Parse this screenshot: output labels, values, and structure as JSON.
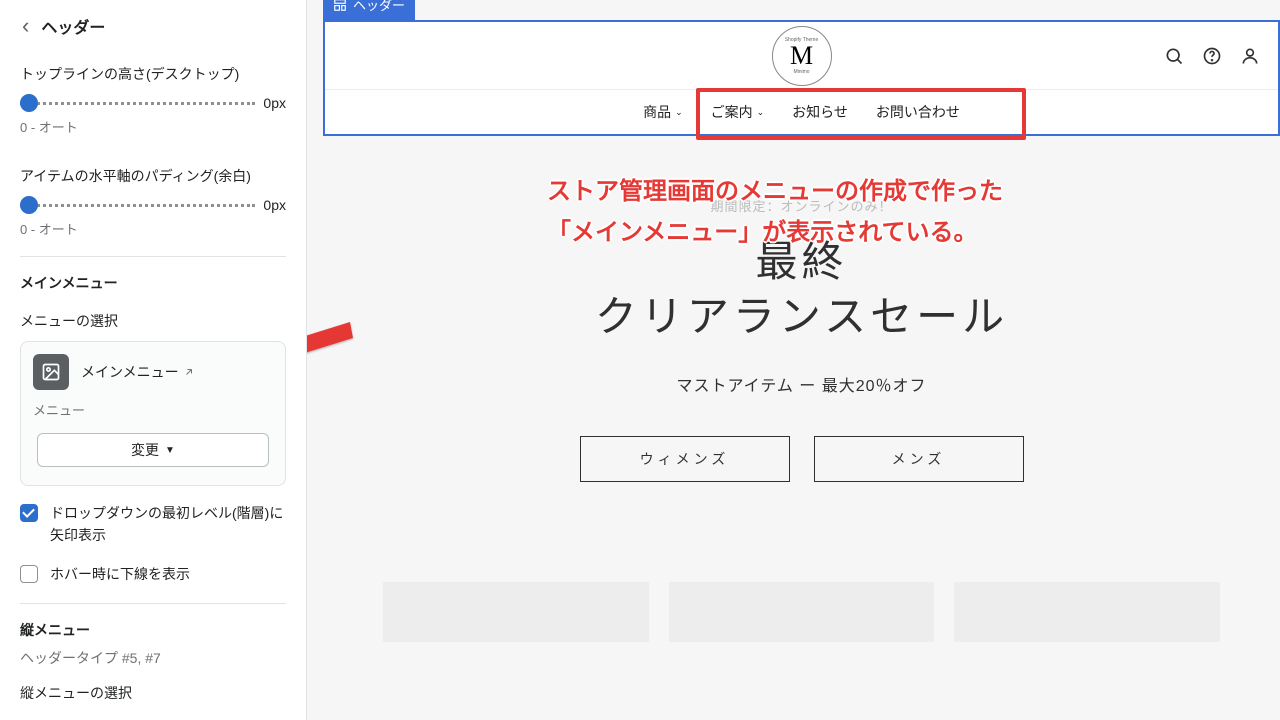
{
  "sidebar": {
    "title": "ヘッダー",
    "setting1": {
      "label": "トップラインの高さ(デスクトップ)",
      "value": "0px",
      "sub": "0 - オート"
    },
    "setting2": {
      "label": "アイテムの水平軸のパディング(余白)",
      "value": "0px",
      "sub": "0 - オート"
    },
    "main_menu": {
      "heading": "メインメニュー",
      "field_label": "メニューの選択",
      "selected_name": "メインメニュー",
      "type_label": "メニュー",
      "change_btn": "変更"
    },
    "checkbox1": "ドロップダウンの最初レベル(階層)に矢印表示",
    "checkbox2": "ホバー時に下線を表示",
    "vertical_menu": {
      "heading": "縦メニュー",
      "sub": "ヘッダータイプ #5, #7",
      "field_label": "縦メニューの選択"
    }
  },
  "preview": {
    "selection_label": "ヘッダー",
    "logo": "M",
    "nav": {
      "item1": "商品",
      "item2": "ご案内",
      "item3": "お知らせ",
      "item4": "お問い合わせ"
    },
    "hero": {
      "eyebrow": "期間限定：オンラインのみ！",
      "title_l1": "最終",
      "title_l2": "クリアランスセール",
      "sub": "マストアイテム ー 最大20％オフ",
      "btn1": "ウィメンズ",
      "btn2": "メンズ"
    }
  },
  "annotation": {
    "line1": "ストア管理画面のメニューの作成で作った",
    "line2": "「メインメニュー」が表示されている。"
  }
}
